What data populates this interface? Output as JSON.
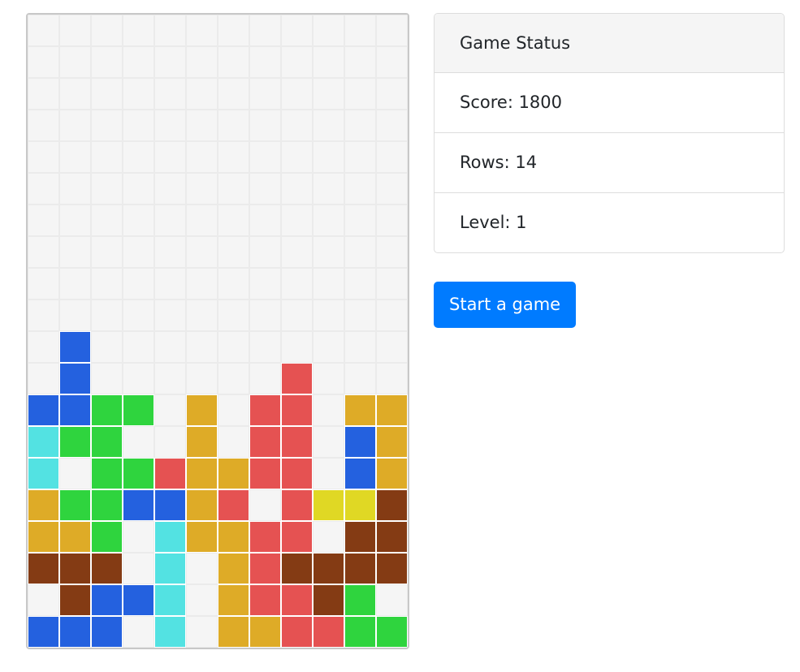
{
  "colors": {
    "B": "#2461df",
    "G": "#2fd43e",
    "C": "#53e2e2",
    "R": "#e55252",
    "O": "#deab27",
    "Y": "#e0d824",
    "N": "#843b14",
    "empty": "#f5f5f5"
  },
  "board": {
    "columns": 12,
    "rows": [
      "............",
      "............",
      "............",
      "............",
      "............",
      "............",
      "............",
      "............",
      "............",
      "............",
      ".B..........",
      ".B......R...",
      "BBGG.O.RR.OO",
      "CGG..O.RR.BO",
      "C.GGROORR.BO",
      "OGGBBOR.RYYN",
      "OOG.COORR.NN",
      "NNN.C.ORNNNN",
      ".NBBC.ORRNG.",
      "BBB.C.OORRGG"
    ]
  },
  "status": {
    "header": "Game Status",
    "score": "Score: 1800",
    "rows": "Rows: 14",
    "level": "Level: 1"
  },
  "start_button": {
    "label": "Start a game"
  }
}
